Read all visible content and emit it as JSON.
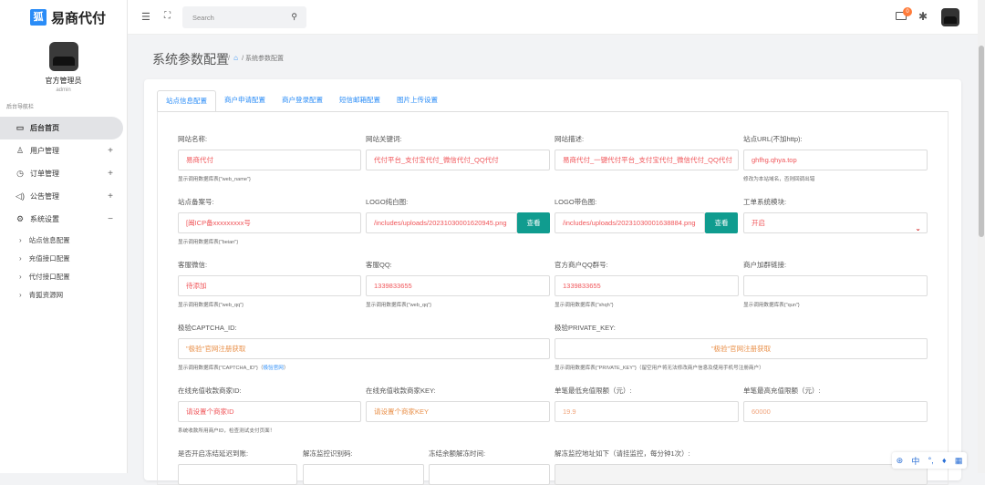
{
  "app": {
    "logo_glyph": "狐",
    "name": "易商代付"
  },
  "user": {
    "name": "官方管理员",
    "role": "admin"
  },
  "sidebar": {
    "nav_label": "后台导航栏",
    "items": [
      {
        "label": "后台首页",
        "icon": "monitor-icon"
      },
      {
        "label": "用户管理",
        "icon": "user-icon",
        "expand": "+"
      },
      {
        "label": "订单管理",
        "icon": "clock-icon",
        "expand": "+"
      },
      {
        "label": "公告管理",
        "icon": "speaker-icon",
        "expand": "+"
      },
      {
        "label": "系统设置",
        "icon": "gear-icon",
        "expand": "−"
      }
    ],
    "sub_items": [
      "站点信息配置",
      "充值接口配置",
      "代付接口配置",
      "青狐资源网"
    ]
  },
  "topbar": {
    "search_placeholder": "Search",
    "mail_badge": "0"
  },
  "page": {
    "title": "系统参数配置",
    "crumb_sep": "/",
    "crumb_current": "系统参数配置"
  },
  "tabs": [
    "站点信息配置",
    "商户申请配置",
    "商户登录配置",
    "短信邮箱配置",
    "图片上传设置"
  ],
  "form": {
    "web_name": {
      "label": "网站名称:",
      "value": "易商代付",
      "hint": "显示调用数据库表{\"web_name\"}"
    },
    "keywords": {
      "label": "网站关键词:",
      "value": "代付平台_支付宝代付_微信代付_QQ代付"
    },
    "description": {
      "label": "网站描述:",
      "value": "易商代付_一键代付平台_支付宝代付_微信代付_QQ代付"
    },
    "site_url": {
      "label": "站点URL(不加http):",
      "value": "ghfhg.qhya.top",
      "hint": "修改为本站域名，否则回调出错"
    },
    "beian": {
      "label": "站点备案号:",
      "value": "[闽ICP备xxxxxxxxx号",
      "hint": "显示调用数据库表{\"beian\"}"
    },
    "logo_white": {
      "label": "LOGO纯白图:",
      "value": "/includes/uploads/20231030001620945.png",
      "button": "查看"
    },
    "logo_color": {
      "label": "LOGO带色图:",
      "value": "/includes/uploads/20231030001638884.png",
      "button": "查看"
    },
    "ticket": {
      "label": "工单系统模块:",
      "value": "开启"
    },
    "wechat": {
      "label": "客服微信:",
      "value": "待添加",
      "hint": "显示调用数据库表{\"web_qq\"}"
    },
    "qq": {
      "label": "客服QQ:",
      "value": "1339833655",
      "hint": "显示调用数据库表{\"web_qq\"}"
    },
    "qq_group": {
      "label": "官方商户QQ群号:",
      "value": "1339833655",
      "hint": "显示调用数据库表{\"shqh\"}"
    },
    "group_link": {
      "label": "商户加群链接:",
      "value": "",
      "hint": "显示调用数据库表{\"qun\"}"
    },
    "captcha_id": {
      "label": "极验CAPTCHA_ID:",
      "value": "\"极验\"官网注册获取",
      "hint": "显示调用数据库表{\"CAPTCHA_ID\"}（",
      "hint_link": "极验官网",
      "hint_end": "）"
    },
    "private_key": {
      "label": "极验PRIVATE_KEY:",
      "value": "\"极验\"官网注册获取",
      "hint": "显示调用数据库表{\"PRIVATE_KEY\"}（留空用户将无法修改商户信息及使用手机号注册商户）"
    },
    "merchant_id": {
      "label": "在线充值收款商家ID:",
      "value": "请设置个商家ID",
      "hint": "系统收款所用商户ID，检查测试支付页面！"
    },
    "merchant_key": {
      "label": "在线充值收款商家KEY:",
      "value": "请设置个商家KEY"
    },
    "min_amount": {
      "label": "单笔最低充值限额（元）:",
      "value": "19.9"
    },
    "max_amount": {
      "label": "单笔最高充值限额（元）:",
      "value": "60000"
    },
    "freeze_delay": {
      "label": "是否开启冻结延迟到账:"
    },
    "unfreeze_code": {
      "label": "解冻监控识别码:"
    },
    "freeze_time": {
      "label": "冻结余额解冻时间:"
    },
    "unfreeze_url": {
      "label": "解冻监控地址如下（请挂监控，每分钟1次）:"
    }
  },
  "float_toolbar": {
    "lang": "中"
  }
}
